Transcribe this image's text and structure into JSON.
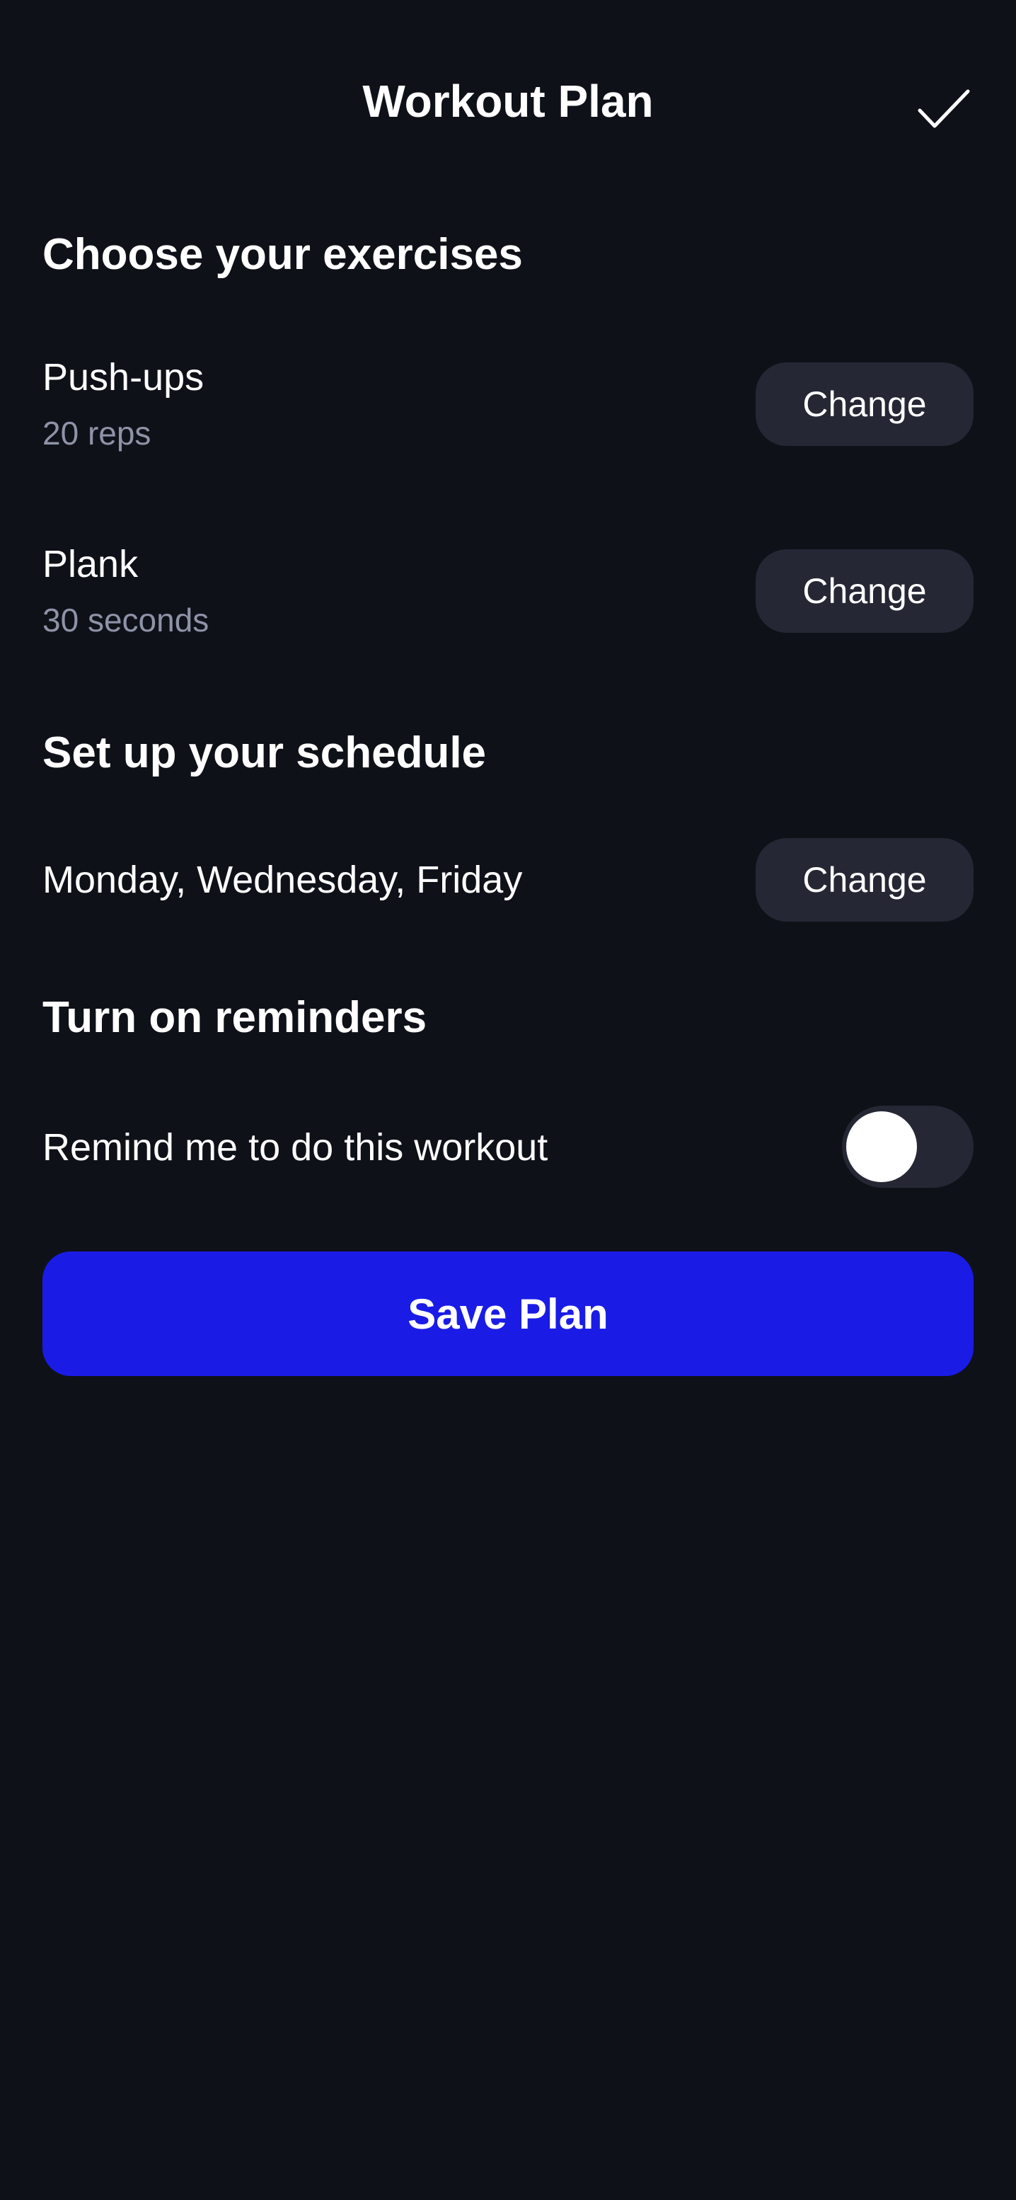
{
  "header": {
    "title": "Workout Plan",
    "done_icon": "checkmark-icon"
  },
  "exercises": {
    "heading": "Choose your exercises",
    "items": [
      {
        "name": "Push-ups",
        "detail": "20 reps",
        "button": "Change"
      },
      {
        "name": "Plank",
        "detail": "30 seconds",
        "button": "Change"
      }
    ]
  },
  "schedule": {
    "heading": "Set up your schedule",
    "days": "Monday, Wednesday, Friday",
    "button": "Change"
  },
  "reminders": {
    "heading": "Turn on reminders",
    "label": "Remind me to do this workout",
    "enabled": false
  },
  "actions": {
    "save_label": "Save Plan"
  },
  "colors": {
    "background": "#0f1119",
    "button_bg": "#252834",
    "accent": "#1a1ce6",
    "muted_text": "#8e93a6"
  }
}
